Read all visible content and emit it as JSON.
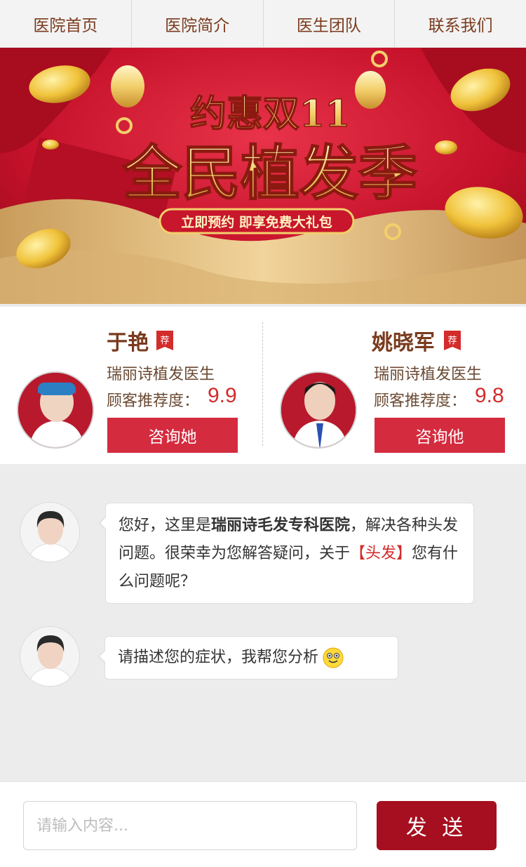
{
  "nav": {
    "items": [
      {
        "label": "医院首页"
      },
      {
        "label": "医院简介"
      },
      {
        "label": "医生团队"
      },
      {
        "label": "联系我们"
      }
    ]
  },
  "banner": {
    "headline_small": "约惠双11",
    "headline_large": "全民植发季",
    "ribbon": "立即预约 即享免费大礼包"
  },
  "doctors": [
    {
      "name": "于艳",
      "badge": "荐",
      "title": "瑞丽诗植发医生",
      "rating_label": "顾客推荐度：",
      "score": "9.9",
      "button": "咨询她"
    },
    {
      "name": "姚晓军",
      "badge": "荐",
      "title": "瑞丽诗植发医生",
      "rating_label": "顾客推荐度：",
      "score": "9.8",
      "button": "咨询他"
    }
  ],
  "chat": {
    "msg1": {
      "part1": "您好，这里是",
      "hospital": "瑞丽诗毛发专科医院",
      "part2": "，解决各种头发问题。很荣幸为您解答疑问，关于",
      "topic": "【头发】",
      "part3": "您有什么问题呢？"
    },
    "msg2": {
      "text": "请描述您的症状，我帮您分析"
    }
  },
  "footer": {
    "input_placeholder": "请输入内容...",
    "send_label": "发 送"
  },
  "colors": {
    "brand_red": "#d42b3f",
    "send_red": "#a50f1f",
    "nav_text": "#7a3b1e"
  }
}
